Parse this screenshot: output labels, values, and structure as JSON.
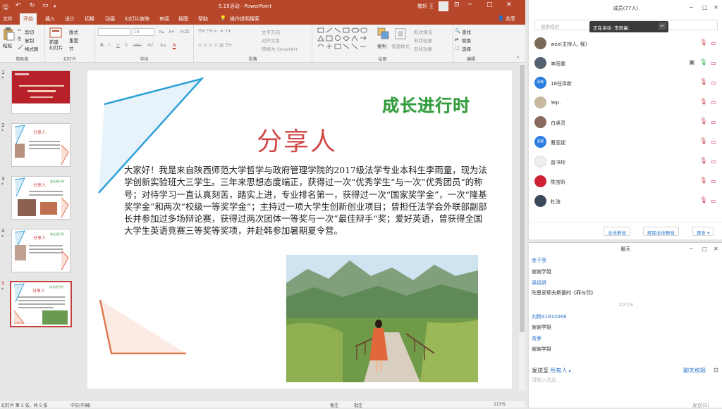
{
  "pp": {
    "window_title": "5.19活动 - PowerPoint",
    "user_name": "敬轩 王",
    "tabs": [
      "文件",
      "开始",
      "插入",
      "设计",
      "切换",
      "动画",
      "幻灯片放映",
      "审阅",
      "视图",
      "帮助",
      "操作说明搜索"
    ],
    "share": "共享",
    "ribbon": {
      "clipboard": {
        "label": "剪贴板",
        "paste": "粘贴",
        "cut": "剪切",
        "copy": "复制",
        "format_painter": "格式刷"
      },
      "slides": {
        "label": "幻灯片",
        "new_slide": "新建\n幻灯片",
        "layout": "版式",
        "reset": "重置",
        "section": "节"
      },
      "font": {
        "label": "字体",
        "size": "18",
        "bold": "B",
        "italic": "I",
        "underline": "U",
        "strike": "S",
        "spacing": "abc",
        "shadow": "AV",
        "case": "Aa",
        "color": "A"
      },
      "paragraph": {
        "label": "段落",
        "text_direction": "文字方向",
        "align_text": "对齐文本",
        "smartart": "转换为 SmartArt"
      },
      "drawing": {
        "label": "绘图",
        "arrange": "排列",
        "quick_styles": "快速样式",
        "fill": "形状填充",
        "outline": "形状轮廓",
        "effect": "形状效果"
      },
      "editing": {
        "label": "编辑",
        "find": "查找",
        "replace": "替换",
        "select": "选择"
      }
    },
    "thumbs": [
      {
        "num": "1",
        "star": "*"
      },
      {
        "num": "2",
        "star": "*"
      },
      {
        "num": "3",
        "star": "*"
      },
      {
        "num": "4",
        "star": "*"
      },
      {
        "num": "5",
        "star": "*"
      }
    ],
    "slide": {
      "brand": "成长进行时",
      "title": "分享人",
      "body": "大家好！我是来自陕西师范大学哲学与政府管理学院的2017级法学专业本科生李雨童，现为法学创新实验班大三学生。三年来思想态度端正，获得过一次“优秀学生“与一次”优秀团员“的称号；对待学习一直认真刻苦，踏实上进，专业排名第一，获得过一次“国家奖学金”，一次“隆基奖学金”和两次“校级一等奖学金“；主持过一项大学生创新创业项目；曾担任法学会外联部副部长并参加过多场辩论赛，获得过两次团体一等奖与一次”最佳辩手“奖；爱好英语，曾获得全国大学生英语竞赛三等奖等奖项，并赴韩参加暑期夏令营。"
    },
    "status": {
      "slide_info": "幻灯片 第 5 张，共 5 张",
      "lang": "中文(中国)",
      "notes": "备注",
      "comments": "批注",
      "zoom": "113%"
    }
  },
  "members": {
    "title": "成员(77人)",
    "search_placeholder": "搜索成员",
    "speaking": "正在讲话: 李雨童;",
    "list": [
      {
        "name": "wzx(主持人, 我)",
        "avatar": "",
        "color": "#7a6a5a"
      },
      {
        "name": "李雨童",
        "avatar": "",
        "color": "#556070"
      },
      {
        "name": "18任泽新",
        "avatar": "泽新",
        "color": "#2b7de0"
      },
      {
        "name": "Yep.",
        "avatar": "",
        "color": "#c8b8a0"
      },
      {
        "name": "白桌灵",
        "avatar": "",
        "color": "#8a6a5a"
      },
      {
        "name": "曹亚妮",
        "avatar": "亚妮",
        "color": "#2b7de0"
      },
      {
        "name": "曾书玲",
        "avatar": "",
        "color": "#eeeeee"
      },
      {
        "name": "陈宝昕",
        "avatar": "",
        "color": "#cc2233"
      },
      {
        "name": "杜淦",
        "avatar": "",
        "color": "#3a4a5a"
      }
    ],
    "mute_all": "全体静音",
    "unmute_all": "解除全体静音",
    "more": "更多"
  },
  "chat": {
    "title": "聊天",
    "messages": [
      {
        "sender": "金子莹",
        "text": "谢谢学姐"
      },
      {
        "sender": "吴钰妍",
        "text": "陀思妥耶夫斯基的《罪与罚》"
      },
      {
        "sender": "刘畅41832068",
        "text": "谢谢学姐"
      },
      {
        "sender": "青萝",
        "text": "谢谢学姐"
      }
    ],
    "time": "20:19",
    "send_to_label": "发送至",
    "send_to_target": "所有人",
    "permission": "聊天权限",
    "input_placeholder": "请输入消息...",
    "send_button": "发送(S)"
  }
}
